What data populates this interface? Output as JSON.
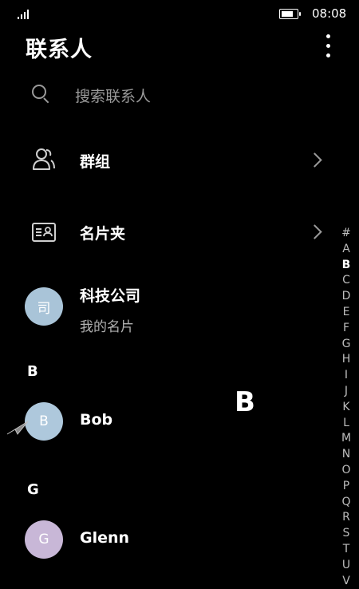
{
  "status": {
    "time": "08:08",
    "battery_level": 0.85
  },
  "header": {
    "title": "联系人",
    "more_icon": "more-vertical-icon"
  },
  "search": {
    "placeholder": "搜索联系人",
    "icon": "search-icon"
  },
  "shortcuts": [
    {
      "label": "群组",
      "icon": "group-icon"
    },
    {
      "label": "名片夹",
      "icon": "business-card-icon"
    }
  ],
  "my_card": {
    "avatar_text": "司",
    "name": "科技公司",
    "subtitle": "我的名片",
    "avatar_color": "#a9c4d8"
  },
  "sections": [
    {
      "letter": "B",
      "contacts": [
        {
          "avatar_text": "B",
          "name": "Bob",
          "avatar_color": "#aec8dc"
        }
      ]
    },
    {
      "letter": "G",
      "contacts": [
        {
          "avatar_text": "G",
          "name": "Glenn",
          "avatar_color": "#c8b7d7"
        }
      ]
    }
  ],
  "index_overlay": "B",
  "alphabet_index": [
    "#",
    "A",
    "B",
    "C",
    "D",
    "E",
    "F",
    "G",
    "H",
    "I",
    "J",
    "K",
    "L",
    "M",
    "N",
    "O",
    "P",
    "Q",
    "R",
    "S",
    "T",
    "U",
    "V"
  ],
  "alphabet_active": "B"
}
